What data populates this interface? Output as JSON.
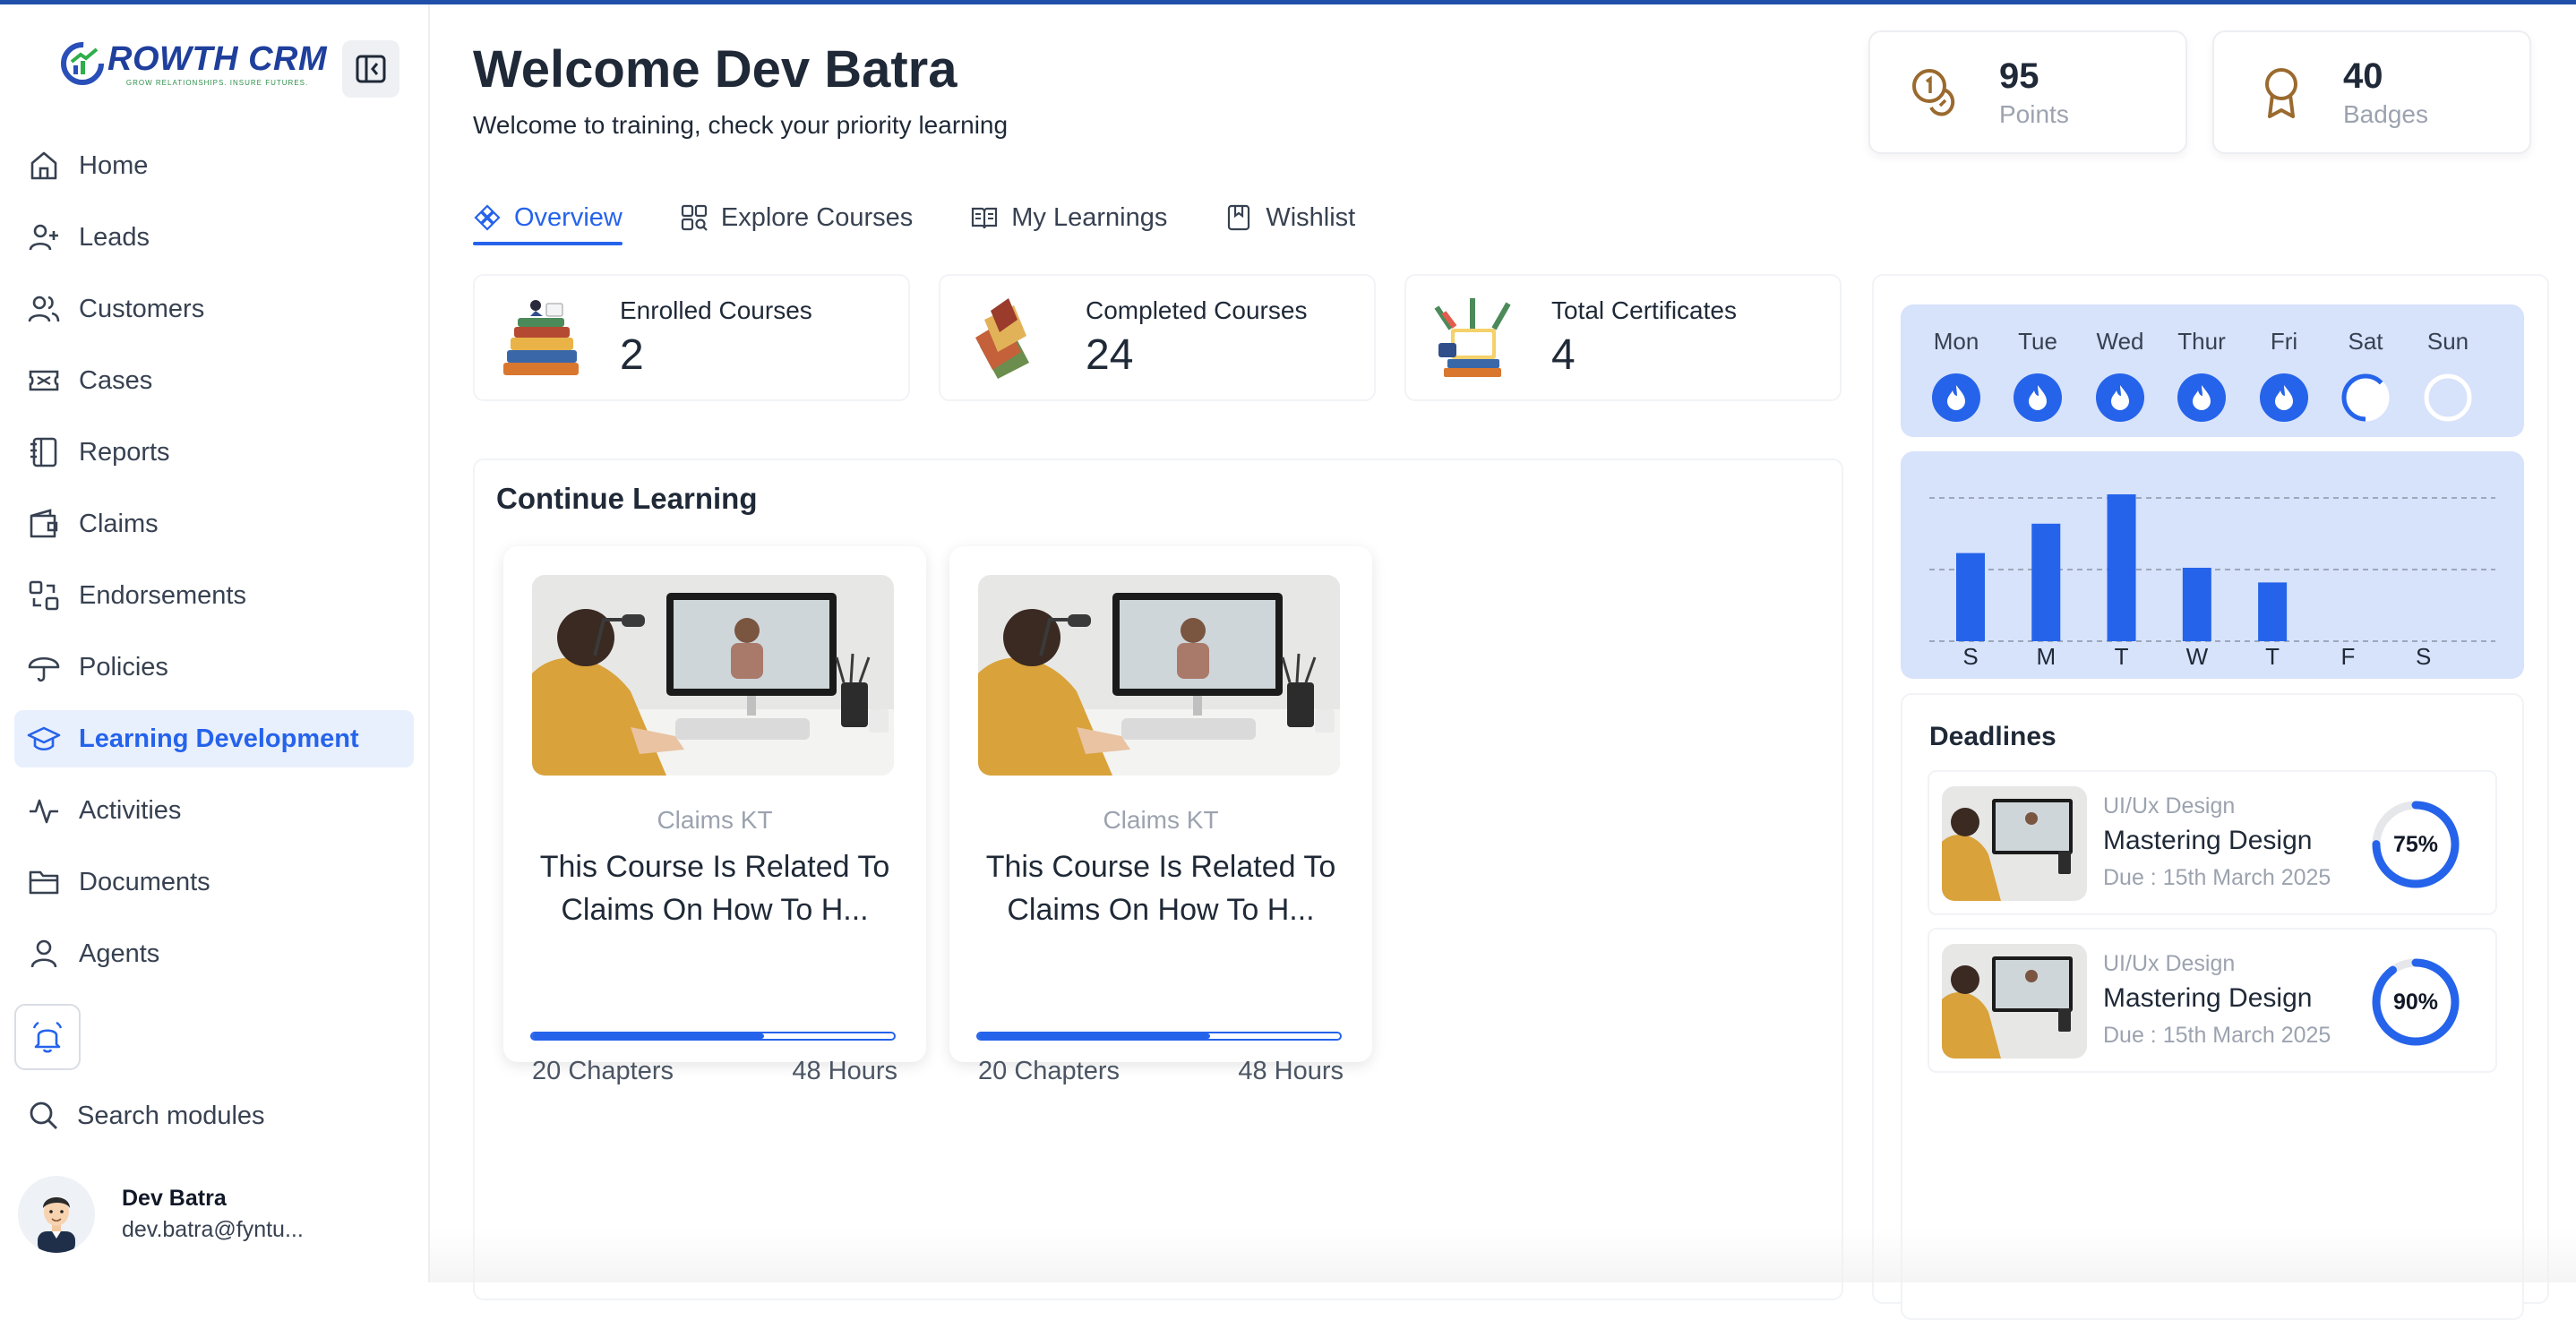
{
  "app": {
    "logo_text_accent": "G",
    "logo_text": "ROWTH CRM",
    "logo_tagline": "GROW RELATIONSHIPS. INSURE FUTURES."
  },
  "sidebar": {
    "items": [
      {
        "label": "Home",
        "icon": "home-icon"
      },
      {
        "label": "Leads",
        "icon": "user-plus-icon"
      },
      {
        "label": "Customers",
        "icon": "users-icon"
      },
      {
        "label": "Cases",
        "icon": "ticket-icon"
      },
      {
        "label": "Reports",
        "icon": "notebook-icon"
      },
      {
        "label": "Claims",
        "icon": "wallet-icon"
      },
      {
        "label": "Endorsements",
        "icon": "transfer-icon"
      },
      {
        "label": "Policies",
        "icon": "umbrella-icon"
      },
      {
        "label": "Learning Development",
        "icon": "graduation-cap-icon",
        "active": true
      },
      {
        "label": "Activities",
        "icon": "activity-icon"
      },
      {
        "label": "Documents",
        "icon": "folder-icon"
      },
      {
        "label": "Agents",
        "icon": "user-icon"
      }
    ],
    "search_label": "Search modules",
    "user": {
      "name": "Dev Batra",
      "email": "dev.batra@fyntu..."
    }
  },
  "header": {
    "title": "Welcome Dev Batra",
    "subtitle": "Welcome to training, check your priority learning",
    "points": {
      "value": "95",
      "label": "Points"
    },
    "badges": {
      "value": "40",
      "label": "Badges"
    }
  },
  "tabs": [
    {
      "label": "Overview",
      "active": true
    },
    {
      "label": "Explore Courses"
    },
    {
      "label": "My Learnings"
    },
    {
      "label": "Wishlist"
    }
  ],
  "summary": [
    {
      "label": "Enrolled Courses",
      "value": "2"
    },
    {
      "label": "Completed Courses",
      "value": "24"
    },
    {
      "label": "Total Certificates",
      "value": "4"
    }
  ],
  "continue_learning": {
    "title": "Continue Learning",
    "courses": [
      {
        "category": "Claims KT",
        "title": "This Course Is Related To Claims On How To H...",
        "progress": 0.64,
        "chapters": "20 Chapters",
        "hours": "48 Hours"
      },
      {
        "category": "Claims KT",
        "title": "This Course Is Related To Claims On How To H...",
        "progress": 0.64,
        "chapters": "20 Chapters",
        "hours": "48 Hours"
      }
    ]
  },
  "streak": {
    "days": [
      {
        "label": "Mon",
        "status": "done"
      },
      {
        "label": "Tue",
        "status": "done"
      },
      {
        "label": "Wed",
        "status": "done"
      },
      {
        "label": "Thur",
        "status": "done"
      },
      {
        "label": "Fri",
        "status": "done"
      },
      {
        "label": "Sat",
        "status": "partial"
      },
      {
        "label": "Sun",
        "status": "empty"
      }
    ]
  },
  "chart_data": {
    "type": "bar",
    "categories": [
      "S",
      "M",
      "T",
      "W",
      "T",
      "F",
      "S"
    ],
    "values": [
      0.6,
      0.8,
      1.0,
      0.5,
      0.4,
      0,
      0
    ],
    "title": "",
    "xlabel": "",
    "ylabel": "",
    "ylim": [
      0,
      1
    ],
    "grid": true,
    "bar_color": "#2563eb"
  },
  "deadlines": {
    "title": "Deadlines",
    "items": [
      {
        "category": "UI/Ux Design",
        "name": "Mastering Design",
        "due": "Due : 15th March 2025",
        "percent_label": "75%",
        "percent": 75
      },
      {
        "category": "UI/Ux Design",
        "name": "Mastering Design",
        "due": "Due : 15th March 2025",
        "percent_label": "90%",
        "percent": 90
      }
    ]
  },
  "colors": {
    "accent": "#2563eb",
    "sidebar_active_bg": "#e8effd",
    "streak_bg": "#d7e2fb"
  }
}
